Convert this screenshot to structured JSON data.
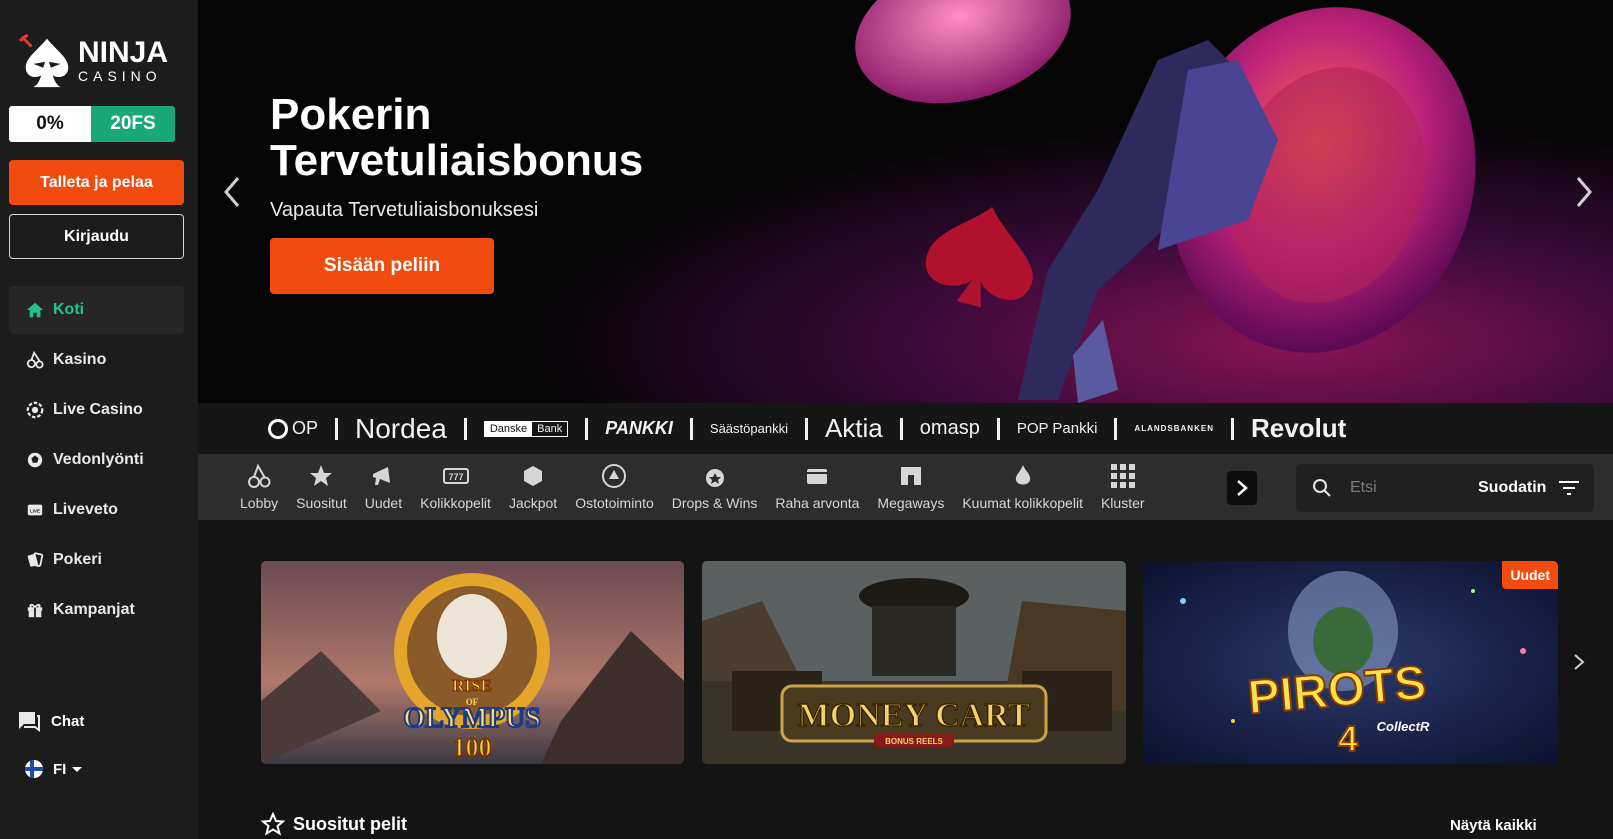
{
  "brand": {
    "line1": "NINJA",
    "line2": "CASINO"
  },
  "promo": {
    "left": "0%",
    "right": "20FS"
  },
  "sidebar": {
    "deposit_label": "Talleta ja pelaa",
    "login_label": "Kirjaudu",
    "items": [
      {
        "label": "Koti",
        "icon": "home-icon",
        "active": true
      },
      {
        "label": "Kasino",
        "icon": "cherries-icon"
      },
      {
        "label": "Live Casino",
        "icon": "chip-icon"
      },
      {
        "label": "Vedonlyönti",
        "icon": "ball-icon"
      },
      {
        "label": "Liveveto",
        "icon": "live-icon"
      },
      {
        "label": "Pokeri",
        "icon": "cards-icon"
      },
      {
        "label": "Kampanjat",
        "icon": "gift-icon"
      }
    ],
    "chat_label": "Chat",
    "language": "FI"
  },
  "hero": {
    "title": "Pokerin Tervetuliaisbonus",
    "subtitle": "Vapauta Tervetuliaisbonuksesi",
    "cta_label": "Sisään peliin"
  },
  "banks": {
    "op": "OP",
    "nordea": "Nordea",
    "danske_a": "Danske",
    "danske_b": "Bank",
    "pankki": "PANKKI",
    "saastopankki": "Säästöpankki",
    "aktia": "Aktia",
    "omasp": "omasp",
    "poppankki": "POP Pankki",
    "alandsbanken": "ALANDSBANKEN",
    "revolut": "Revolut"
  },
  "categories": [
    {
      "label": "Lobby",
      "icon": "cherries-icon"
    },
    {
      "label": "Suositut",
      "icon": "star-icon"
    },
    {
      "label": "Uudet",
      "icon": "megaphone-icon"
    },
    {
      "label": "Kolikkopelit",
      "icon": "slot-icon"
    },
    {
      "label": "Jackpot",
      "icon": "jackpot-icon"
    },
    {
      "label": "Ostotoiminto",
      "icon": "buy-icon"
    },
    {
      "label": "Drops & Wins",
      "icon": "drops-icon"
    },
    {
      "label": "Raha arvonta",
      "icon": "wallet-icon"
    },
    {
      "label": "Megaways",
      "icon": "megaways-icon"
    },
    {
      "label": "Kuumat kolikkopelit",
      "icon": "flame-icon"
    },
    {
      "label": "Kluster",
      "icon": "grid-icon"
    }
  ],
  "search": {
    "placeholder": "Etsi",
    "filter_label": "Suodatin"
  },
  "games": [
    {
      "title_lines": [
        "RISE",
        "OF",
        "OLYMPUS",
        "100"
      ]
    },
    {
      "title_lines": [
        "MONEY CART",
        "BONUS REELS"
      ]
    },
    {
      "title_lines": [
        "PIROTS",
        "4",
        "CollectR"
      ],
      "badge": "Uudet"
    }
  ],
  "section": {
    "title": "Suositut pelit",
    "see_all": "Näytä kaikki"
  },
  "colors": {
    "accent": "#f24b0f",
    "green": "#19a978",
    "active_nav": "#22c38a"
  }
}
